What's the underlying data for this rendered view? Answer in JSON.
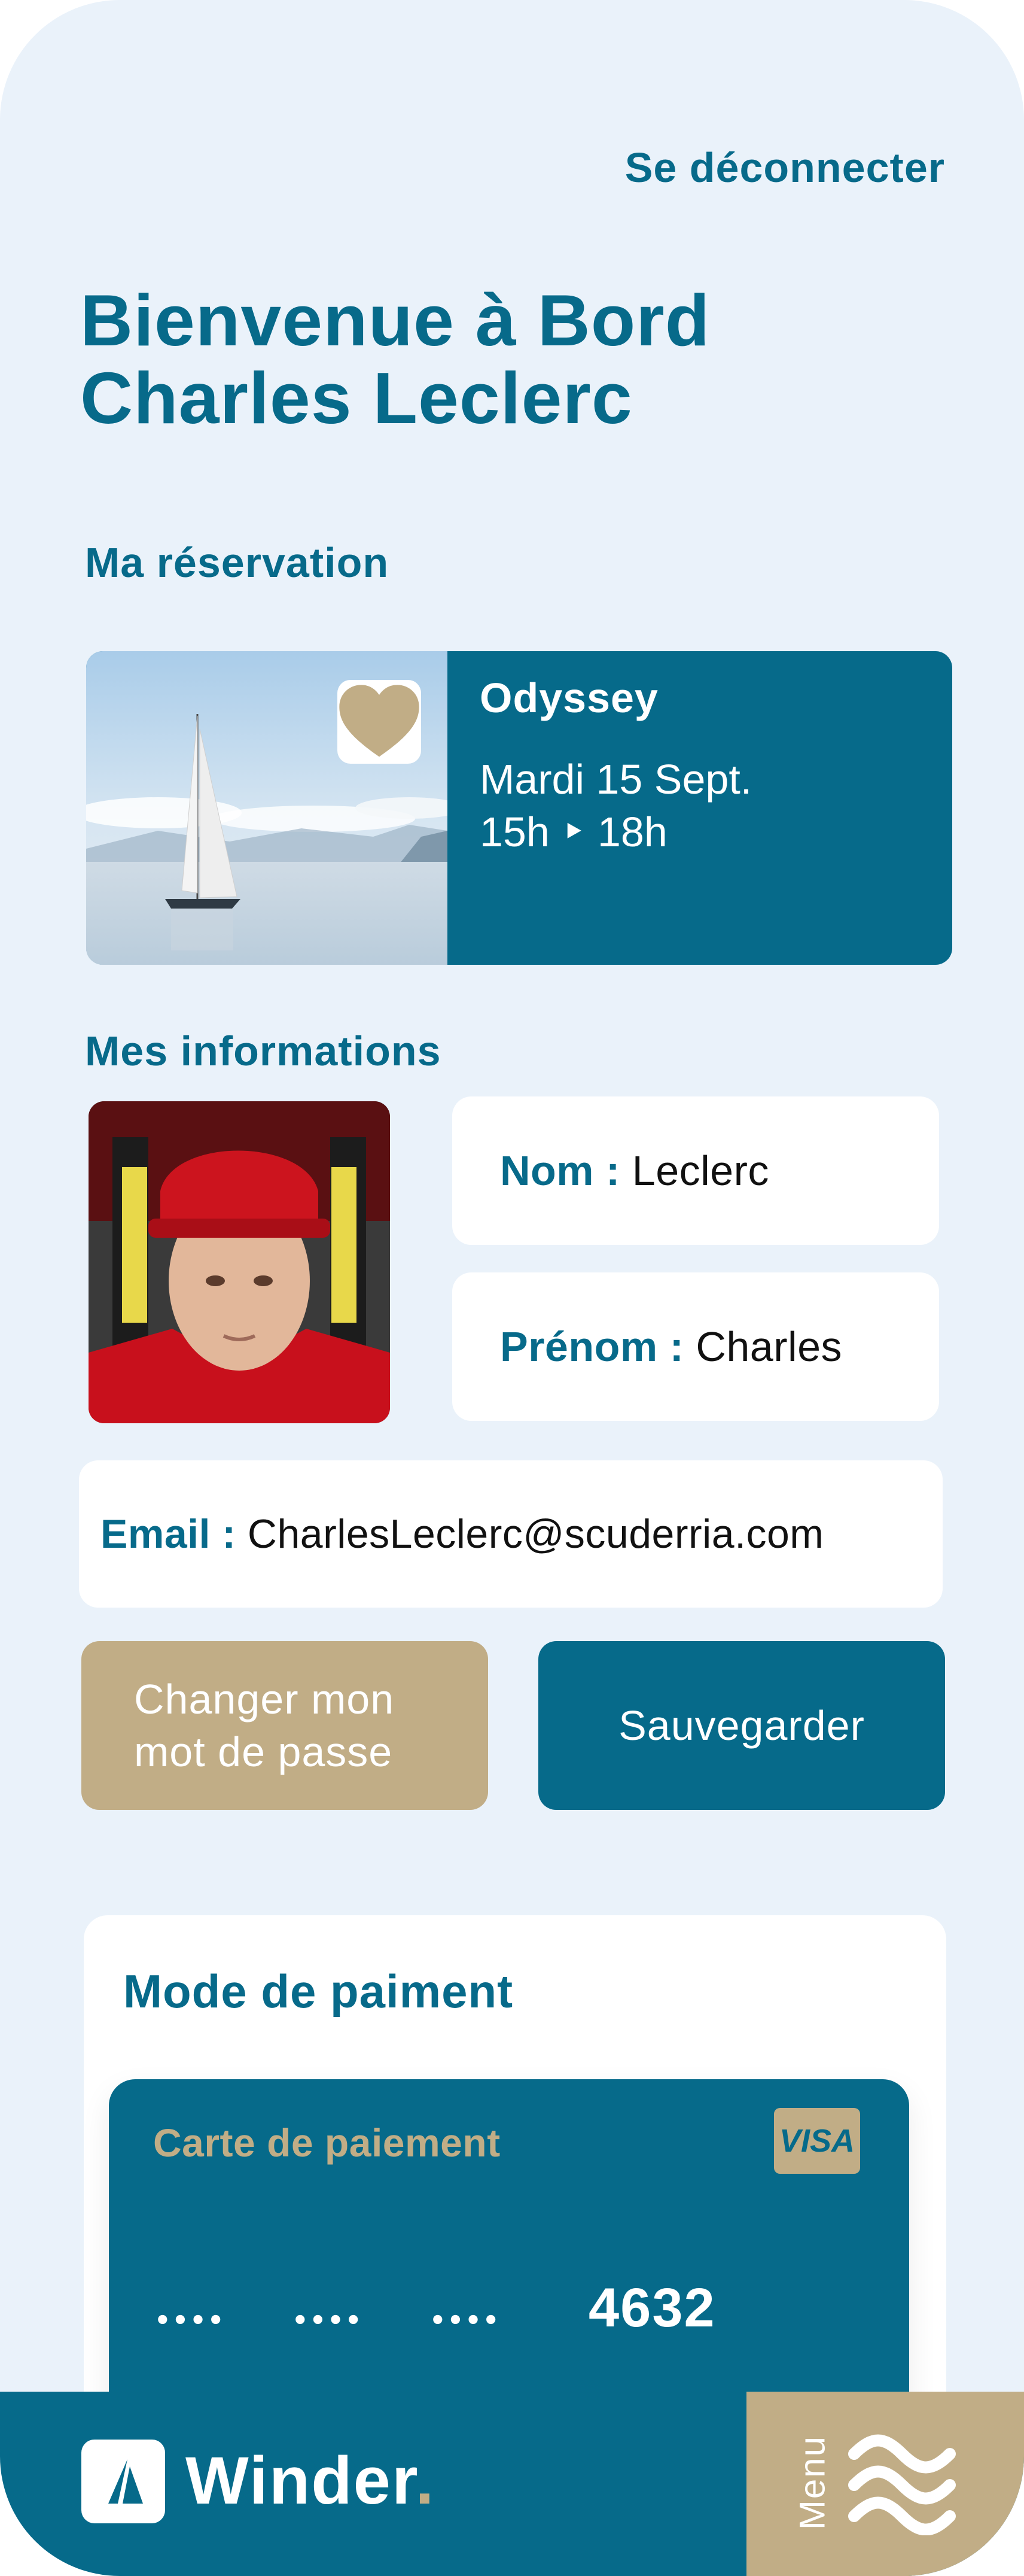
{
  "header": {
    "logout_label": "Se déconnecter",
    "welcome_line1": "Bienvenue à Bord",
    "welcome_line2": "Charles Leclerc"
  },
  "reservation": {
    "section_title": "Ma réservation",
    "boat_name": "Odyssey",
    "date": "Mardi 15 Sept.",
    "time": "15h ‣ 18h",
    "favorite_icon": "heart-icon"
  },
  "info": {
    "section_title": "Mes informations",
    "last_name_label": "Nom : ",
    "last_name_value": "Leclerc",
    "first_name_label": "Prénom : ",
    "first_name_value": "Charles",
    "email_label": "Email : ",
    "email_value": "CharlesLeclerc@scuderria.com"
  },
  "actions": {
    "change_password_line1": "Changer mon",
    "change_password_line2": "mot de passe",
    "save_label": "Sauvegarder"
  },
  "payment": {
    "section_title": "Mode de paiment",
    "card_label": "Carte de paiement",
    "card_brand": "VISA",
    "masked_group_1": "••••",
    "masked_group_2": "••••",
    "masked_group_3": "••••",
    "last_digits": "4632"
  },
  "bottom_bar": {
    "brand_name": "Winder",
    "brand_dot": ".",
    "menu_label": "Menu"
  },
  "colors": {
    "primary": "#066a8a",
    "gold": "#c1ad86",
    "background": "#eaf2fa",
    "surface": "#ffffff"
  }
}
